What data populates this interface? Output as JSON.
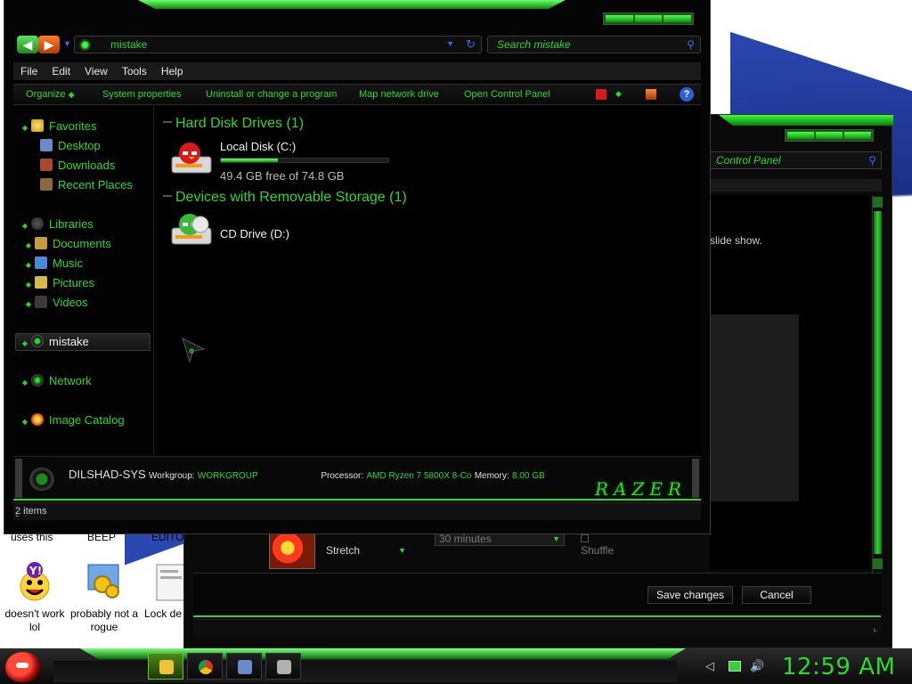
{
  "explorer": {
    "address_path": "mistake",
    "search_placeholder": "Search mistake",
    "menu": [
      "File",
      "Edit",
      "View",
      "Tools",
      "Help"
    ],
    "commands": {
      "organize": "Organize",
      "system_properties": "System properties",
      "uninstall": "Uninstall or change a program",
      "map_drive": "Map network drive",
      "control_panel": "Open Control Panel"
    },
    "nav": {
      "favorites": "Favorites",
      "desktop": "Desktop",
      "downloads": "Downloads",
      "recent": "Recent Places",
      "libraries": "Libraries",
      "documents": "Documents",
      "music": "Music",
      "pictures": "Pictures",
      "videos": "Videos",
      "computer": "mistake",
      "network": "Network",
      "image_catalog": "Image Catalog"
    },
    "groups": {
      "hdd": "Hard Disk Drives (1)",
      "removable": "Devices with Removable Storage (1)"
    },
    "drives": {
      "c_name": "Local Disk (C:)",
      "c_free": "49.4 GB free of 74.8 GB",
      "c_used_fraction": 0.34,
      "d_name": "CD Drive (D:)"
    },
    "details": {
      "computer_name": "DILSHAD-SYS",
      "workgroup_key": "Workgroup:",
      "workgroup_val": "WORKGROUP",
      "processor_key": "Processor:",
      "processor_val": "AMD Ryzen 7 5800X 8-Co",
      "memory_key": "Memory:",
      "memory_val": "8.00 GB"
    },
    "brand": "RAZER",
    "status": "2 items"
  },
  "control_panel": {
    "search_placeholder": "Control Panel",
    "description_fragment": "slide show.",
    "picture_position": "Stretch",
    "interval": "30 minutes",
    "shuffle": "Shuffle",
    "save": "Save changes",
    "cancel": "Cancel"
  },
  "desktop": {
    "partial_labels": [
      "uses this",
      "BEEP",
      "EDITO"
    ],
    "icons": [
      {
        "label": "doesn't work lol"
      },
      {
        "label": "probably not a rogue"
      },
      {
        "label": "Lock de"
      }
    ]
  },
  "taskbar": {
    "clock": "12:59 AM"
  },
  "colors": {
    "accent": "#2fd62f",
    "window_bg": "#050505",
    "link_blue": "#3a6bff"
  }
}
